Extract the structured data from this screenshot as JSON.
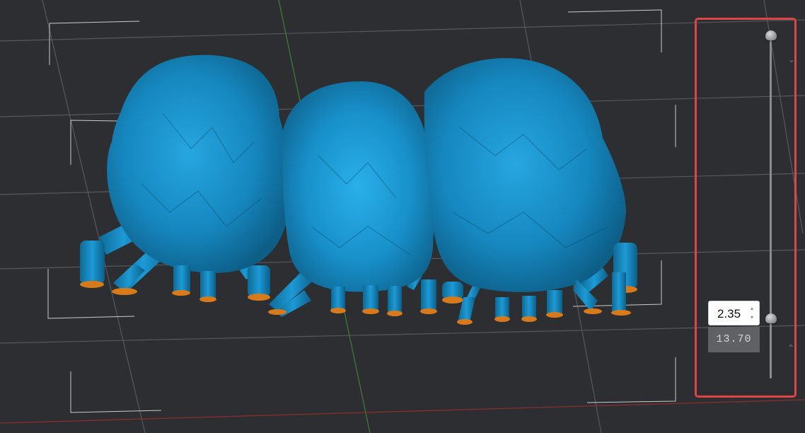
{
  "layer_slider": {
    "current_layer": "2.35",
    "total_height": "13.70",
    "upper_handle_fraction": 1.0,
    "lower_handle_fraction": 0.17
  },
  "icons": {
    "spin_up": "▴",
    "spin_down": "▾",
    "collapse_up": "⌃",
    "expand_down": "⌄"
  },
  "colors": {
    "background": "#2c2e31",
    "model_blue": "#1a8fc8",
    "support_tip": "#d97a1a",
    "highlight_box": "#e04545",
    "axis_y": "#3f7a2e",
    "axis_x": "#8a2f2f"
  }
}
